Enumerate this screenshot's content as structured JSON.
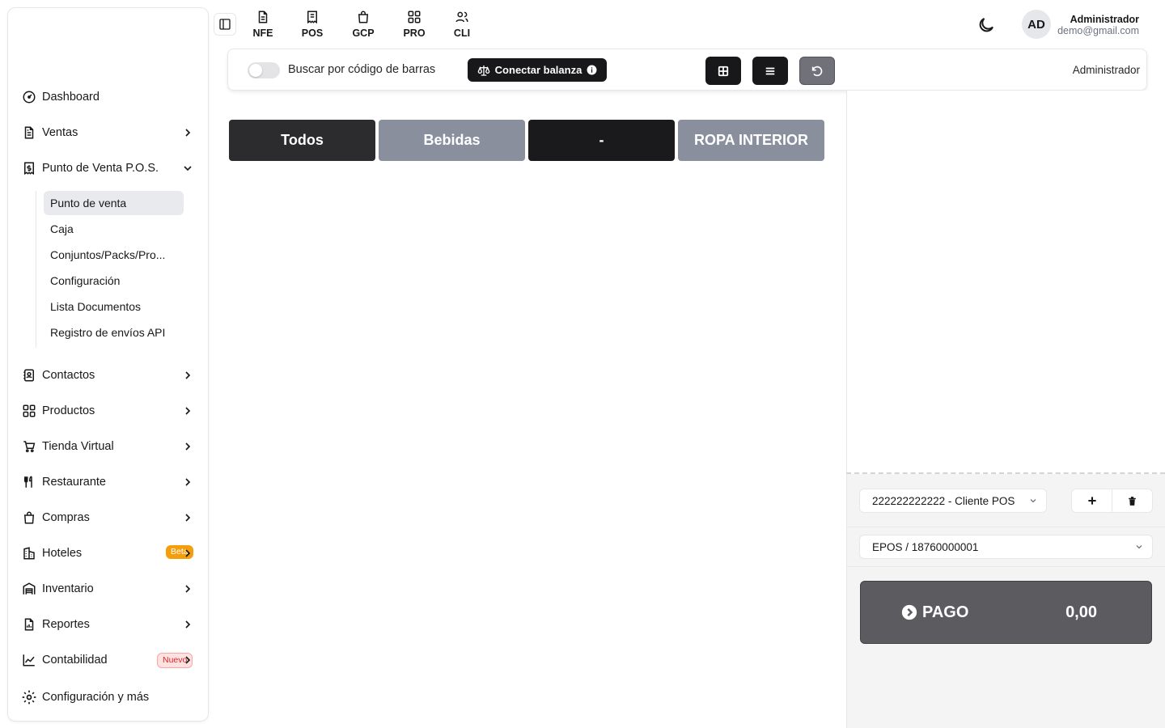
{
  "sidebar": {
    "items": [
      {
        "label": "Dashboard",
        "icon": "gauge-icon"
      },
      {
        "label": "Ventas",
        "icon": "file-text-icon"
      },
      {
        "label": "Punto de Venta P.O.S.",
        "icon": "receipt-dollar-icon"
      },
      {
        "label": "Contactos",
        "icon": "contact-book-icon"
      },
      {
        "label": "Productos",
        "icon": "grid-icon"
      },
      {
        "label": "Tienda Virtual",
        "icon": "cart-icon"
      },
      {
        "label": "Restaurante",
        "icon": "utensils-icon"
      },
      {
        "label": "Compras",
        "icon": "shopping-bag-icon"
      },
      {
        "label": "Hoteles",
        "icon": "hotel-icon",
        "badge": "Beta"
      },
      {
        "label": "Inventario",
        "icon": "warehouse-icon"
      },
      {
        "label": "Reportes",
        "icon": "report-icon"
      },
      {
        "label": "Contabilidad",
        "icon": "chart-icon",
        "badge": "Nuevo"
      },
      {
        "label": "Configuración y más",
        "icon": "gear-icon"
      }
    ],
    "pos_submenu": [
      "Punto de venta",
      "Caja",
      "Conjuntos/Packs/Pro...",
      "Configuración",
      "Lista Documentos",
      "Registro de envíos API"
    ]
  },
  "topnav": [
    {
      "label": "NFE",
      "icon": "document-icon"
    },
    {
      "label": "POS",
      "icon": "receipt-icon"
    },
    {
      "label": "GCP",
      "icon": "bag-icon"
    },
    {
      "label": "PRO",
      "icon": "grid-icon"
    },
    {
      "label": "CLI",
      "icon": "users-icon"
    }
  ],
  "user": {
    "initials": "AD",
    "name": "Administrador",
    "email": "demo@gmail.com"
  },
  "toolbar": {
    "barcode_label": "Buscar por código de barras",
    "balanza_label": "Conectar balanza",
    "user_label": "Administrador"
  },
  "categories": [
    {
      "label": "Todos",
      "color": "#2c2c2e"
    },
    {
      "label": "Bebidas",
      "color": "#8a8f9e"
    },
    {
      "label": "-",
      "color": "#1a1a1c"
    },
    {
      "label": "ROPA INTERIOR",
      "color": "#8a8f9e"
    }
  ],
  "cart": {
    "customer": "222222222222 - Cliente POS",
    "series": "EPOS / 18760000001",
    "pay_label": "PAGO",
    "total": "0,00"
  },
  "colors": {
    "dark": "#18181b",
    "pay_button": "#5b5b60",
    "beta_badge": "#f59e0b",
    "nuevo_badge": "#dc2626"
  }
}
